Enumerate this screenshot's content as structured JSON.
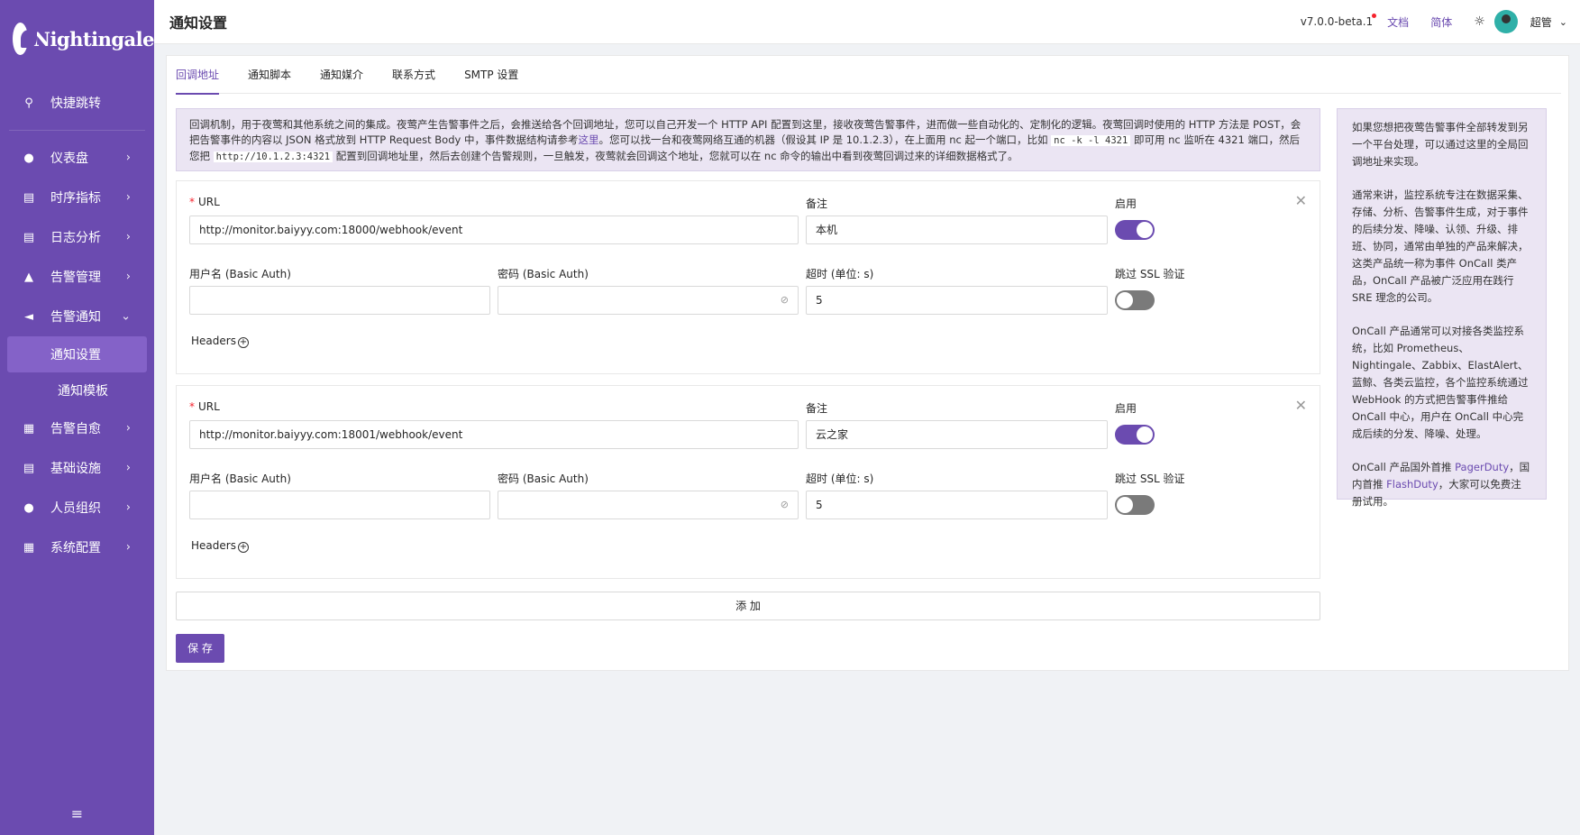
{
  "app": {
    "logo_text": "Nightingale"
  },
  "sidebar": {
    "items": [
      {
        "label": "快捷跳转",
        "icon": "search-icon"
      },
      {
        "label": "仪表盘",
        "icon": "dashboard-icon"
      },
      {
        "label": "时序指标",
        "icon": "chart-icon"
      },
      {
        "label": "日志分析",
        "icon": "log-icon"
      },
      {
        "label": "告警管理",
        "icon": "alarm-icon"
      },
      {
        "label": "告警通知",
        "icon": "megaphone-icon"
      },
      {
        "label": "通知设置"
      },
      {
        "label": "通知模板"
      },
      {
        "label": "告警自愈",
        "icon": "terminal-icon"
      },
      {
        "label": "基础设施",
        "icon": "server-icon"
      },
      {
        "label": "人员组织",
        "icon": "user-icon"
      },
      {
        "label": "系统配置",
        "icon": "settings-icon"
      }
    ]
  },
  "header": {
    "title": "通知设置",
    "version": "v7.0.0-beta.1",
    "docs": "文档",
    "lang": "简体",
    "user": "超管"
  },
  "tabs": [
    "回调地址",
    "通知脚本",
    "通知媒介",
    "联系方式",
    "SMTP 设置"
  ],
  "intro": {
    "part1": "回调机制，用于夜莺和其他系统之间的集成。夜莺产生告警事件之后，会推送给各个回调地址，您可以自己开发一个 HTTP API 配置到这里，接收夜莺告警事件，进而做一些自动化的、定制化的逻辑。夜莺回调时使用的 HTTP 方法是 POST，会把告警事件的内容以 JSON 格式放到 HTTP Request Body 中，事件数据结构请参考",
    "link": "这里",
    "part2": "。您可以找一台和夜莺网络互通的机器（假设其 IP 是 10.1.2.3），在上面用 nc 起一个端口，比如 ",
    "code1": "nc -k -l 4321",
    "part3": " 即可用 nc 监听在 4321 端口，然后您把 ",
    "code2": "http://10.1.2.3:4321",
    "part4": " 配置到回调地址里，然后去创建个告警规则，一旦触发，夜莺就会回调这个地址，您就可以在 nc 命令的输出中看到夜莺回调过来的详细数据格式了。"
  },
  "labels": {
    "url": "URL",
    "note": "备注",
    "enable": "启用",
    "username": "用户名 (Basic Auth)",
    "password": "密码 (Basic Auth)",
    "timeout": "超时 (单位: s)",
    "skip_ssl": "跳过 SSL 验证",
    "headers": "Headers",
    "add": "添 加",
    "save": "保 存"
  },
  "webhooks": [
    {
      "url": "http://monitor.baiyyy.com:18000/webhook/event",
      "note": "本机",
      "enabled": true,
      "username": "",
      "password": "",
      "timeout": "5",
      "skip_ssl": false
    },
    {
      "url": "http://monitor.baiyyy.com:18001/webhook/event",
      "note": "云之家",
      "enabled": true,
      "username": "",
      "password": "",
      "timeout": "5",
      "skip_ssl": false
    }
  ],
  "side_note": {
    "p1": "如果您想把夜莺告警事件全部转发到另一个平台处理，可以通过这里的全局回调地址来实现。",
    "p2": "通常来讲，监控系统专注在数据采集、存储、分析、告警事件生成，对于事件的后续分发、降噪、认领、升级、排班、协同，通常由单独的产品来解决，这类产品统一称为事件 OnCall 类产品，OnCall 产品被广泛应用在践行 SRE 理念的公司。",
    "p3": "OnCall 产品通常可以对接各类监控系统，比如 Prometheus、Nightingale、Zabbix、ElastAlert、蓝鲸、各类云监控，各个监控系统通过 WebHook 的方式把告警事件推给 OnCall 中心，用户在 OnCall 中心完成后续的分发、降噪、处理。",
    "p4a": "OnCall 产品国外首推 ",
    "link1": "PagerDuty",
    "p4b": "，国内首推 ",
    "link2": "FlashDuty",
    "p4c": "，大家可以免费注册试用。"
  }
}
